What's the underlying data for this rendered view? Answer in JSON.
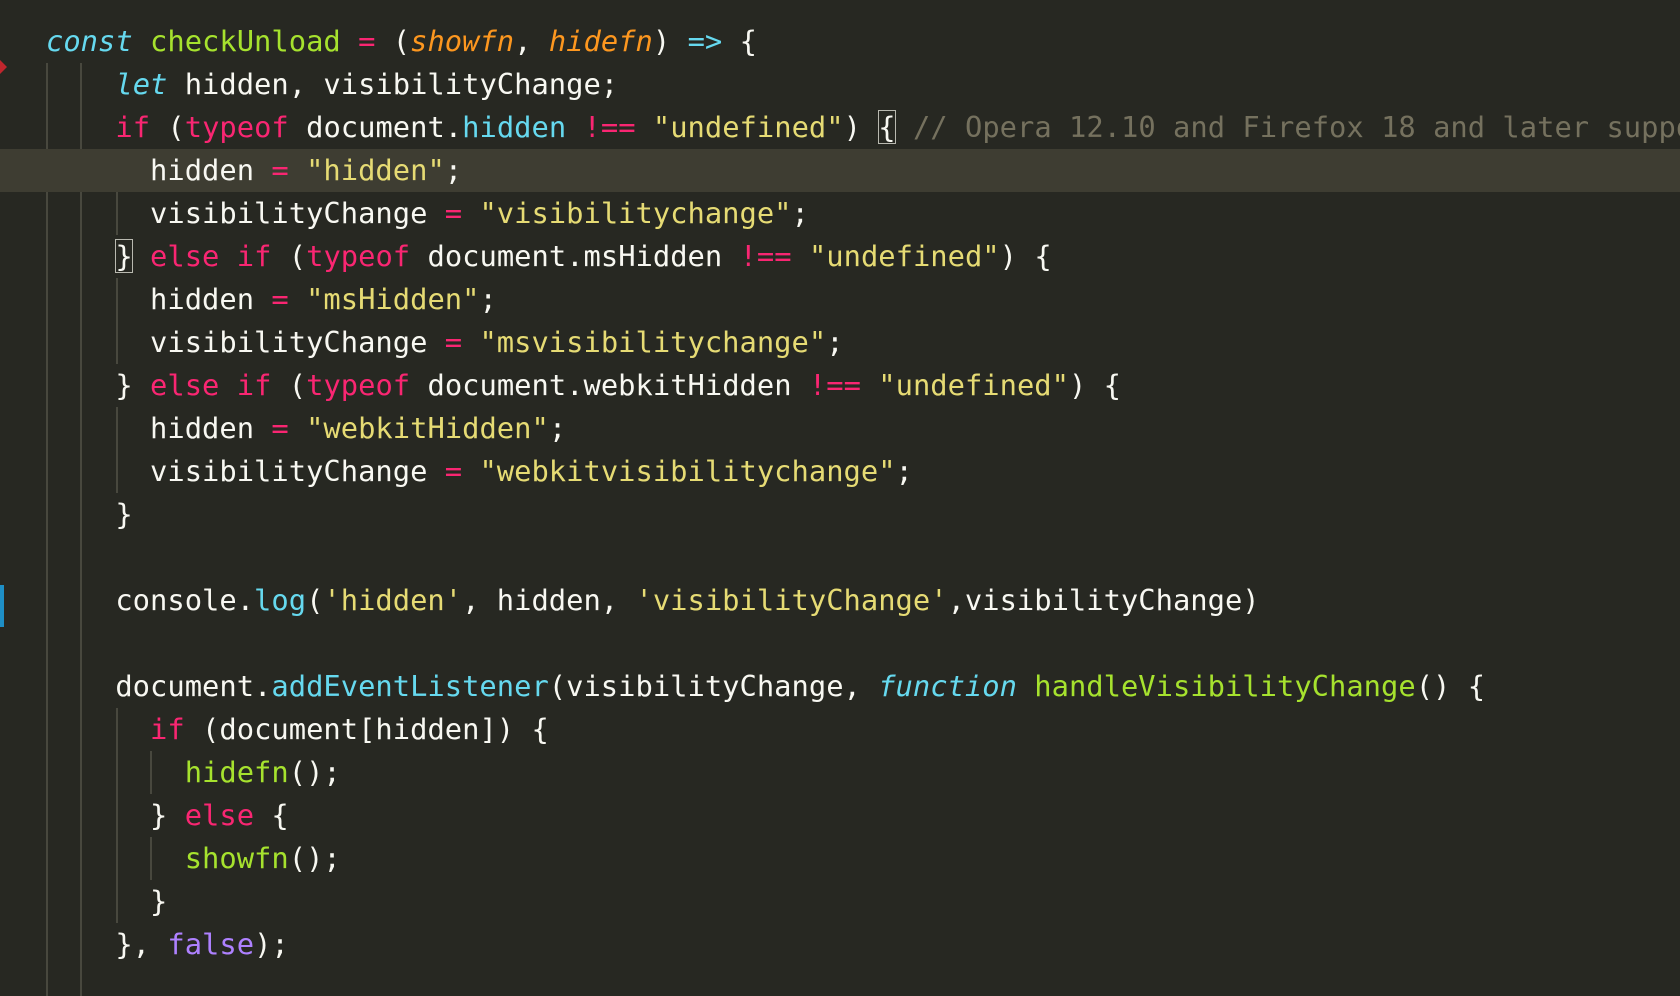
{
  "editor": {
    "theme": "monokai",
    "colors": {
      "background": "#272822",
      "highlight": "#3e3d32",
      "keyword": "#f92672",
      "storage": "#66d9ef",
      "function": "#a6e22e",
      "parameter": "#fd971f",
      "string": "#e6db74",
      "comment": "#75715e",
      "boolean": "#ae81ff",
      "text": "#f8f8f2"
    },
    "gutter_markers": [
      "breakpoint-arrow-icon",
      "modified-line-bar"
    ],
    "lines": [
      [
        [
          "sk",
          "const"
        ],
        [
          "w",
          " "
        ],
        [
          "f",
          "checkUnload"
        ],
        [
          "w",
          " "
        ],
        [
          "o",
          "="
        ],
        [
          "w",
          " ("
        ],
        [
          "p",
          "showfn"
        ],
        [
          "w",
          ", "
        ],
        [
          "p",
          "hidefn"
        ],
        [
          "w",
          ") "
        ],
        [
          "sk",
          "=>"
        ],
        [
          "w",
          " {"
        ]
      ],
      [
        [
          "w",
          "    "
        ],
        [
          "sk",
          "let"
        ],
        [
          "w",
          " hidden, visibilityChange;"
        ]
      ],
      [
        [
          "w",
          "    "
        ],
        [
          "k",
          "if"
        ],
        [
          "w",
          " ("
        ],
        [
          "k",
          "typeof"
        ],
        [
          "w",
          " document."
        ],
        [
          "pr",
          "hidden"
        ],
        [
          "w",
          " "
        ],
        [
          "o",
          "!=="
        ],
        [
          "w",
          " "
        ],
        [
          "s",
          "\"undefined\""
        ],
        [
          "w",
          ") "
        ],
        [
          "box",
          "{"
        ],
        [
          "w",
          " "
        ],
        [
          "c",
          "// Opera 12.10 and Firefox 18 and later suppo"
        ]
      ],
      [
        [
          "w",
          "      hidden "
        ],
        [
          "o",
          "="
        ],
        [
          "w",
          " "
        ],
        [
          "s",
          "\"hidden\""
        ],
        [
          "w",
          ";"
        ]
      ],
      [
        [
          "w",
          "      visibilityChange "
        ],
        [
          "o",
          "="
        ],
        [
          "w",
          " "
        ],
        [
          "s",
          "\"visibilitychange\""
        ],
        [
          "w",
          ";"
        ]
      ],
      [
        [
          "w",
          "    "
        ],
        [
          "box",
          "}"
        ],
        [
          "w",
          " "
        ],
        [
          "k",
          "else"
        ],
        [
          "w",
          " "
        ],
        [
          "k",
          "if"
        ],
        [
          "w",
          " ("
        ],
        [
          "k",
          "typeof"
        ],
        [
          "w",
          " document.msHidden "
        ],
        [
          "o",
          "!=="
        ],
        [
          "w",
          " "
        ],
        [
          "s",
          "\"undefined\""
        ],
        [
          "w",
          ") {"
        ]
      ],
      [
        [
          "w",
          "      hidden "
        ],
        [
          "o",
          "="
        ],
        [
          "w",
          " "
        ],
        [
          "s",
          "\"msHidden\""
        ],
        [
          "w",
          ";"
        ]
      ],
      [
        [
          "w",
          "      visibilityChange "
        ],
        [
          "o",
          "="
        ],
        [
          "w",
          " "
        ],
        [
          "s",
          "\"msvisibilitychange\""
        ],
        [
          "w",
          ";"
        ]
      ],
      [
        [
          "w",
          "    } "
        ],
        [
          "k",
          "else"
        ],
        [
          "w",
          " "
        ],
        [
          "k",
          "if"
        ],
        [
          "w",
          " ("
        ],
        [
          "k",
          "typeof"
        ],
        [
          "w",
          " document.webkitHidden "
        ],
        [
          "o",
          "!=="
        ],
        [
          "w",
          " "
        ],
        [
          "s",
          "\"undefined\""
        ],
        [
          "w",
          ") {"
        ]
      ],
      [
        [
          "w",
          "      hidden "
        ],
        [
          "o",
          "="
        ],
        [
          "w",
          " "
        ],
        [
          "s",
          "\"webkitHidden\""
        ],
        [
          "w",
          ";"
        ]
      ],
      [
        [
          "w",
          "      visibilityChange "
        ],
        [
          "o",
          "="
        ],
        [
          "w",
          " "
        ],
        [
          "s",
          "\"webkitvisibilitychange\""
        ],
        [
          "w",
          ";"
        ]
      ],
      [
        [
          "w",
          "    }"
        ]
      ],
      [],
      [
        [
          "w",
          "    console."
        ],
        [
          "pr",
          "log"
        ],
        [
          "w",
          "("
        ],
        [
          "s",
          "'hidden'"
        ],
        [
          "w",
          ", hidden, "
        ],
        [
          "s",
          "'visibilityChange'"
        ],
        [
          "w",
          ",visibilityChange)"
        ]
      ],
      [],
      [
        [
          "w",
          "    document."
        ],
        [
          "pr",
          "addEventListener"
        ],
        [
          "w",
          "(visibilityChange, "
        ],
        [
          "sk",
          "function"
        ],
        [
          "w",
          " "
        ],
        [
          "f",
          "handleVisibilityChange"
        ],
        [
          "w",
          "() {"
        ]
      ],
      [
        [
          "w",
          "      "
        ],
        [
          "k",
          "if"
        ],
        [
          "w",
          " (document[hidden]) {"
        ]
      ],
      [
        [
          "w",
          "        "
        ],
        [
          "f",
          "hidefn"
        ],
        [
          "w",
          "();"
        ]
      ],
      [
        [
          "w",
          "      } "
        ],
        [
          "k",
          "else"
        ],
        [
          "w",
          " {"
        ]
      ],
      [
        [
          "w",
          "        "
        ],
        [
          "f",
          "showfn"
        ],
        [
          "w",
          "();"
        ]
      ],
      [
        [
          "w",
          "      }"
        ]
      ],
      [
        [
          "w",
          "    }, "
        ],
        [
          "b",
          "false"
        ],
        [
          "w",
          ");"
        ]
      ]
    ]
  }
}
